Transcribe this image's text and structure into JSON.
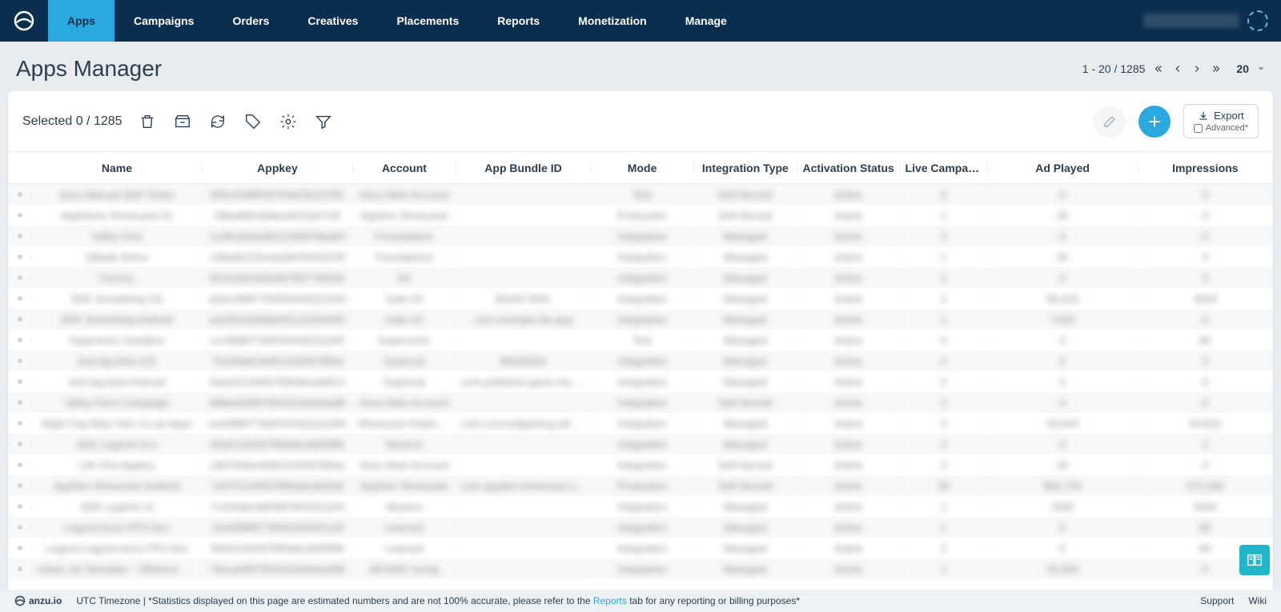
{
  "nav": {
    "tabs": [
      "Apps",
      "Campaigns",
      "Orders",
      "Creatives",
      "Placements",
      "Reports",
      "Monetization",
      "Manage"
    ],
    "active": 0
  },
  "page": {
    "title": "Apps Manager",
    "range": "1 - 20 / 1285",
    "page_size": "20"
  },
  "toolbar": {
    "selected": "Selected 0 / 1285",
    "export": "Export",
    "advanced": "Advanced*"
  },
  "columns": [
    "Name",
    "Appkey",
    "Account",
    "App Bundle ID",
    "Mode",
    "Integration Type",
    "Activation Status",
    "Live Campaigns",
    "Ad Played",
    "Impressions"
  ],
  "rows": [
    {
      "name": "Anzu Manual SDK Tester",
      "appkey": "f0Rc02d9R0675rkkOb1075D",
      "account": "Anzu Main Account",
      "bundle": "",
      "mode": "Test",
      "integration": "Self-Served",
      "activation": "Active",
      "live": "3",
      "ad_played": "0",
      "impressions": "0",
      "blur": true
    },
    {
      "name": "AppName Showcase 01",
      "appkey": "08ba9dfc00abcdef12ef7c0f",
      "account": "AppDev Showcase",
      "bundle": "",
      "mode": "Production",
      "integration": "Self-Served",
      "activation": "Active",
      "live": "1",
      "ad_played": "30",
      "impressions": "0",
      "blur": true
    },
    {
      "name": "Valley One",
      "appkey": "1c2fe1b0ea9012345678aab0",
      "account": "Foundations",
      "bundle": "",
      "mode": "Integration",
      "integration": "Managed",
      "activation": "Active",
      "live": "2",
      "ad_played": "0",
      "impressions": "0",
      "blur": true,
      "activationOther": true
    },
    {
      "name": "1Blade Demo",
      "appkey": "c08adb123c4ae987654321f0",
      "account": "Foundations",
      "bundle": "",
      "mode": "Integration",
      "integration": "Managed",
      "activation": "Active",
      "live": "1",
      "ad_played": "40",
      "impressions": "0",
      "blur": true
    },
    {
      "name": "Factory",
      "appkey": "0f1e2d3c4b5a69788776655e",
      "account": "AZ",
      "bundle": "",
      "mode": "Integration",
      "integration": "Managed",
      "activation": "Active",
      "live": "2",
      "ad_played": "0",
      "impressions": "3",
      "blur": true
    },
    {
      "name": "SDK Something OS",
      "appkey": "aa0cc9887766554433221100",
      "account": "Gate AZ",
      "bundle": "Bank0 5001",
      "mode": "Integration",
      "integration": "Managed",
      "activation": "Active",
      "live": "2",
      "ad_played": "96,023",
      "impressions": "4629",
      "blur": true
    },
    {
      "name": "SDK Something Android",
      "appkey": "aa1501028d9e0f1122334455",
      "account": "Gate AZ",
      "bundle": "com.example.tile.app",
      "mode": "Integration",
      "integration": "Managed",
      "activation": "Active",
      "live": "1",
      "ad_played": "7,820",
      "impressions": "0",
      "blur": true
    },
    {
      "name": "Supersonic Sandbox",
      "appkey": "ccc99887766554433221100f",
      "account": "Supersonic",
      "bundle": "",
      "mode": "Test",
      "integration": "Managed",
      "activation": "Active",
      "live": "0",
      "ad_played": "0",
      "impressions": "80",
      "blur": true
    },
    {
      "name": "Anti-lag beta iOS",
      "appkey": "7fce98abcdef01234567890a",
      "account": "Supernal",
      "bundle": "86935634",
      "mode": "Integration",
      "integration": "Managed",
      "activation": "Active",
      "live": "0",
      "ad_played": "0",
      "impressions": "0",
      "blur": true
    },
    {
      "name": "Anti-lag beta Android",
      "appkey": "0aae31234567890abcdef012",
      "account": "Supernal",
      "bundle": "com.publisher.game.mobile.us",
      "mode": "Integration",
      "integration": "Managed",
      "activation": "Active",
      "live": "0",
      "ad_played": "0",
      "impressions": "0",
      "blur": true
    },
    {
      "name": "Valley Farm Campaign",
      "appkey": "d9bea00987654321fedcba98",
      "account": "Anzu Main Account",
      "bundle": "",
      "mode": "Integration",
      "integration": "Self-Served",
      "activation": "Active",
      "live": "2",
      "ad_played": "0",
      "impressions": "0",
      "blur": true
    },
    {
      "name": "Night Fog Wars Sim Co-op Apps",
      "appkey": "cee998877665544332211000",
      "account": "Showcase Publishing",
      "bundle": "com.concordgaming.wildriding",
      "mode": "Integration",
      "integration": "Managed",
      "activation": "Active",
      "live": "3",
      "ad_played": "52,840",
      "impressions": "64,822",
      "blur": true
    },
    {
      "name": "SDK Legend v3.x",
      "appkey": "80ef1234567890abcdef0998",
      "account": "Neutron",
      "bundle": "",
      "mode": "Integration",
      "integration": "Managed",
      "activation": "Active",
      "live": "2",
      "ad_played": "0",
      "impressions": "2",
      "blur": true
    },
    {
      "name": "Life Cha Appkey",
      "appkey": "c8b790abcdef0123456789aa",
      "account": "Anzu Main Account",
      "bundle": "",
      "mode": "Integration",
      "integration": "Self-Served",
      "activation": "Active",
      "live": "3",
      "ad_played": "30",
      "impressions": "0",
      "blur": true
    },
    {
      "name": "AppDev Showcase Android",
      "appkey": "7e97f1234567890abcde00af",
      "account": "AppDev Showcase",
      "bundle": "com.appdev.showcase.android",
      "mode": "Production",
      "integration": "Self-Served",
      "activation": "Active",
      "live": "30",
      "ad_played": "882,734",
      "impressions": "572,280",
      "blur": true
    },
    {
      "name": "SDK Legend v3",
      "appkey": "7c104abcdef0987654321100",
      "account": "Neutron",
      "bundle": "",
      "mode": "Integration",
      "integration": "Managed",
      "activation": "Active",
      "live": "1",
      "ad_played": "2560",
      "impressions": "5640",
      "blur": true
    },
    {
      "name": "Legend Anzu FPS Dev",
      "appkey": "10e6998877665544332211ff",
      "account": "Learned",
      "bundle": "",
      "mode": "Integration",
      "integration": "Managed",
      "activation": "Active",
      "live": "1",
      "ad_played": "0",
      "impressions": "80",
      "blur": true
    },
    {
      "name": "Legend Legend Anzu FPS Dev",
      "appkey": "80ef1234567890abcdef0998",
      "account": "Learned",
      "bundle": "",
      "mode": "Integration",
      "integration": "Managed",
      "activation": "Active",
      "live": "2",
      "ad_played": "0",
      "impressions": "80",
      "blur": true
    },
    {
      "name": "Urban Jet Simulator - Offshore Arctic",
      "appkey": "76eca0987654321fedcba098",
      "account": "MGAM3 racing",
      "bundle": "",
      "mode": "Integration",
      "integration": "Managed",
      "activation": "Active",
      "live": "1",
      "ad_played": "32,863",
      "impressions": "0",
      "blur": true
    }
  ],
  "footer": {
    "brand": "anzu.io",
    "tz": "UTC Timezone |",
    "disclaimer_pre": "*Statistics displayed on this page are estimated numbers and are not 100% accurate, please refer to the ",
    "disclaimer_link": "Reports",
    "disclaimer_post": " tab for any reporting or billing purposes*",
    "support": "Support",
    "wiki": "Wiki"
  }
}
